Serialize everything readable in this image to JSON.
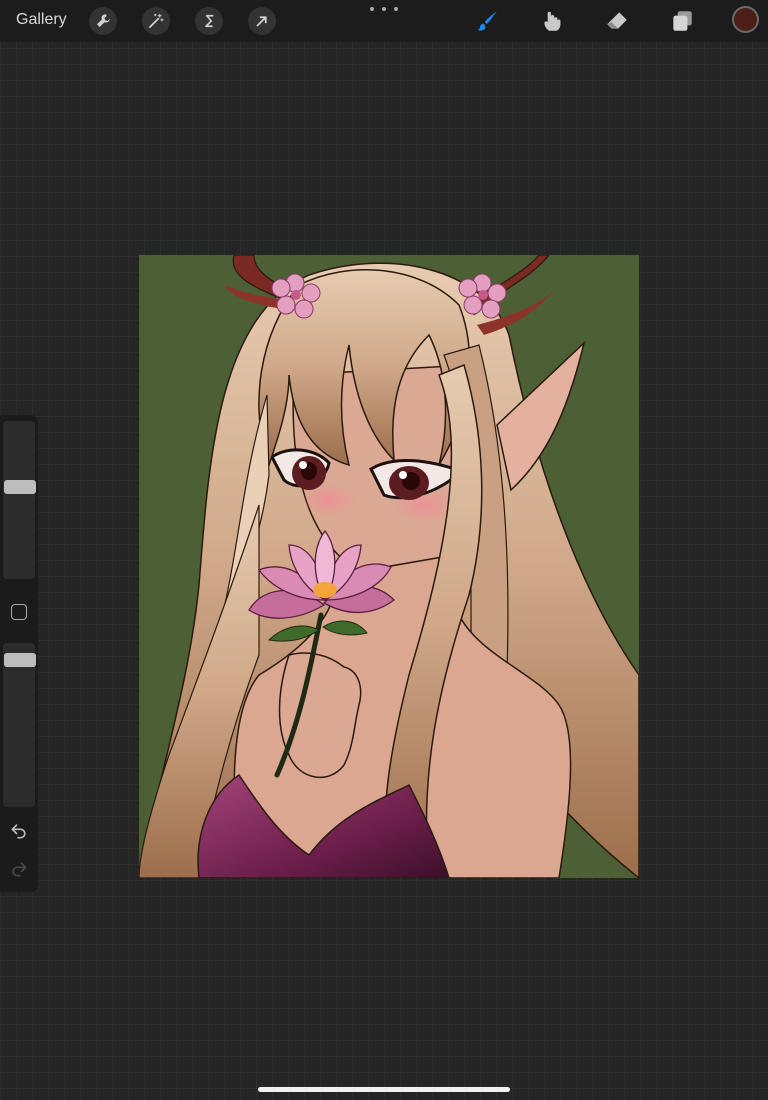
{
  "toolbar": {
    "gallery_label": "Gallery",
    "left_tools": [
      {
        "name": "actions",
        "icon": "wrench-icon"
      },
      {
        "name": "adjustments",
        "icon": "magic-wand-icon"
      },
      {
        "name": "selection",
        "icon": "selection-s-icon"
      },
      {
        "name": "transform",
        "icon": "arrow-cursor-icon"
      }
    ],
    "more_icon": "ellipsis-icon",
    "right_tools": [
      {
        "name": "brush",
        "icon": "brush-icon",
        "active": true
      },
      {
        "name": "smudge",
        "icon": "smudge-finger-icon",
        "active": false
      },
      {
        "name": "eraser",
        "icon": "eraser-icon",
        "active": false
      },
      {
        "name": "layers",
        "icon": "layers-icon",
        "active": false
      }
    ],
    "current_color": "#4a1f18",
    "active_color": "#1e88f0"
  },
  "sidebar": {
    "brush_size_level": 0.6,
    "brush_opacity_level": 0.97,
    "modify_icon": "square-icon",
    "undo_icon": "undo-icon",
    "redo_icon": "redo-icon"
  },
  "canvas": {
    "background_color": "#4d5f35",
    "artwork": "illustration"
  }
}
